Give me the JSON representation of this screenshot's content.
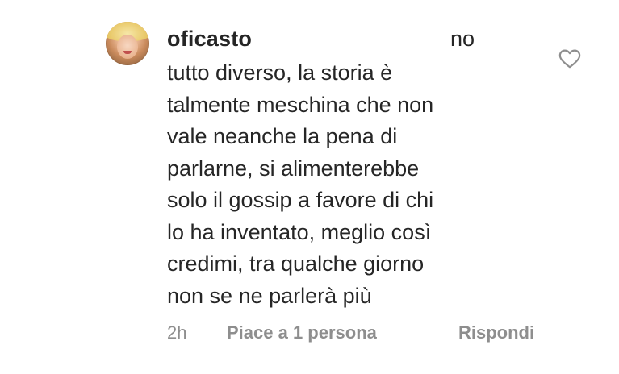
{
  "comment": {
    "username": "oficasto",
    "first_line_tail": "no",
    "lines": [
      "tutto diverso, la storia è",
      "talmente meschina che non",
      "vale neanche la pena di",
      "parlarne, si alimenterebbe",
      "solo il gossip a favore di chi",
      "lo ha inventato, meglio così",
      "credimi, tra qualche giorno",
      "non se ne parlerà più"
    ],
    "like_icon": "heart-outline-icon",
    "meta": {
      "time": "2h",
      "likes": "Piace a 1 persona",
      "reply": "Rispondi"
    }
  },
  "colors": {
    "text": "#262626",
    "meta": "#8e8e8e"
  }
}
